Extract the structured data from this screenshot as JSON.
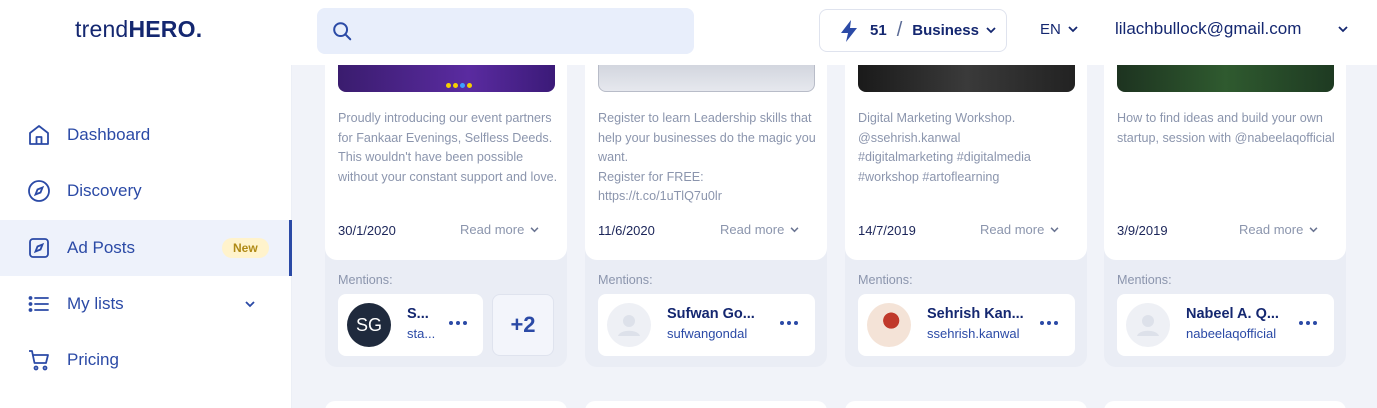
{
  "header": {
    "logo_prefix": "trend",
    "logo_bold": "HERO.",
    "search": {
      "placeholder": ""
    },
    "credits": {
      "count": "51",
      "separator": "/",
      "plan": "Business"
    },
    "language": "EN",
    "user_email": "lilachbullock@gmail.com"
  },
  "sidebar": {
    "items": [
      {
        "label": "Dashboard",
        "icon": "home-icon"
      },
      {
        "label": "Discovery",
        "icon": "compass-icon"
      },
      {
        "label": "Ad Posts",
        "icon": "ad-post-icon",
        "badge": "New",
        "active": true
      },
      {
        "label": "My lists",
        "icon": "list-icon",
        "expandable": true
      },
      {
        "label": "Pricing",
        "icon": "cart-icon"
      }
    ]
  },
  "cards": [
    {
      "caption": "Proudly introducing our event partners for Fankaar Evenings, Selfless Deeds. This wouldn't have been possible without your constant support and love.",
      "date": "30/1/2020",
      "read_more": "Read more",
      "mentions_label": "Mentions:",
      "mention": {
        "initials": "SG",
        "name": "S...",
        "handle": "sta..."
      },
      "more_mentions": "+2"
    },
    {
      "caption": "Register to learn Leadership skills that help your businesses do the magic you want.\nRegister for FREE:\nhttps://t.co/1uTlQ7u0lr",
      "date": "11/6/2020",
      "read_more": "Read more",
      "mentions_label": "Mentions:",
      "mention": {
        "name": "Sufwan Go...",
        "handle": "sufwangondal"
      }
    },
    {
      "caption": "Digital Marketing Workshop.\n@ssehrish.kanwal\n#digitalmarketing #digitalmedia\n#workshop #artoflearning",
      "date": "14/7/2019",
      "read_more": "Read more",
      "mentions_label": "Mentions:",
      "mention": {
        "name": "Sehrish Kan...",
        "handle": "ssehrish.kanwal"
      }
    },
    {
      "caption": "How to find ideas and build your own startup, session with @nabeelaqofficial",
      "date": "3/9/2019",
      "read_more": "Read more",
      "mentions_label": "Mentions:",
      "mention": {
        "name": "Nabeel A. Q...",
        "handle": "nabeelaqofficial"
      }
    }
  ],
  "colors": {
    "brand": "#142770",
    "accent": "#2b4aa6",
    "badge_bg": "#fff3cc",
    "badge_text": "#b08a16"
  }
}
